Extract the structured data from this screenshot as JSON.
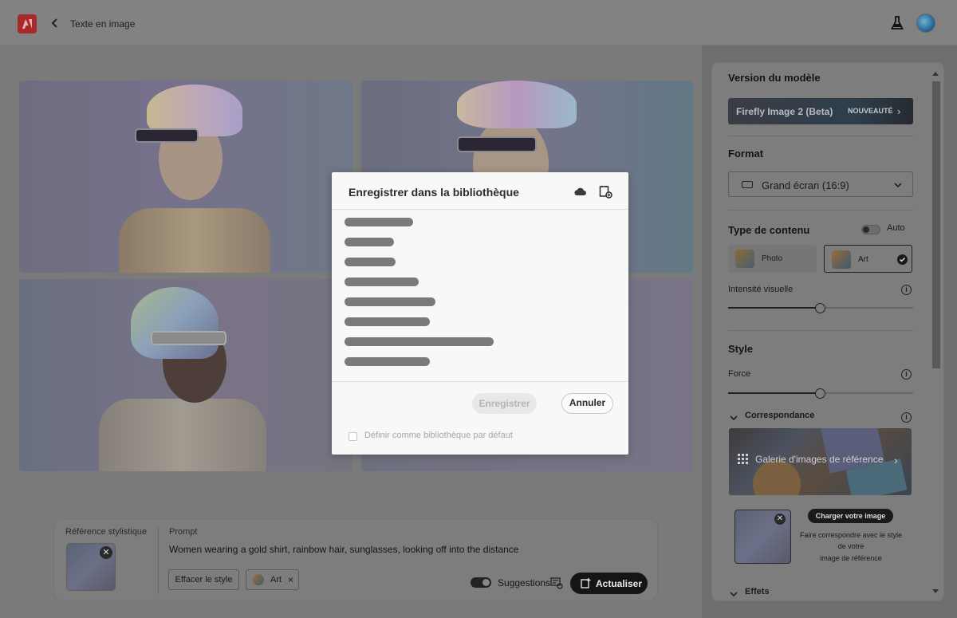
{
  "header": {
    "title": "Texte en image",
    "logo_icon": "adobe-icon",
    "back_icon": "chevron-left-icon",
    "flask_icon": "flask-icon",
    "avatar_icon": "user-avatar"
  },
  "prompt_panel": {
    "reference_label": "Référence stylistique",
    "prompt_label": "Prompt",
    "prompt_text": "Women wearing a gold shirt, rainbow hair, sunglasses, looking off into the distance",
    "clear_style_label": "Effacer le style",
    "art_chip_label": "Art",
    "art_chip_remove": "×",
    "suggestions_label": "Suggestions",
    "refresh_label": "Actualiser"
  },
  "right_panel": {
    "model_version_heading": "Version du modèle",
    "model_name": "Firefly Image 2 (Beta)",
    "model_badge": "NOUVEAUTÉ",
    "format_heading": "Format",
    "format_value": "Grand écran (16:9)",
    "content_type_heading": "Type de contenu",
    "auto_label": "Auto",
    "content_types": [
      {
        "label": "Photo",
        "selected": false
      },
      {
        "label": "Art",
        "selected": true
      }
    ],
    "visual_intensity_label": "Intensité visuelle",
    "visual_intensity_value": 0.5,
    "style_heading": "Style",
    "strength_label": "Force",
    "strength_value": 0.5,
    "match_label": "Correspondance",
    "gallery_label": "Galerie d'images de référence",
    "upload_button_label": "Charger votre image",
    "upload_desc_line1": "Faire correspondre avec le style",
    "upload_desc_line2": "de votre",
    "upload_desc_line3": "image de référence",
    "effects_label": "Effets"
  },
  "modal": {
    "title": "Enregistrer dans la bibliothèque",
    "save_label": "Enregistrer",
    "cancel_label": "Annuler",
    "default_library_label": "Définir comme bibliothèque par défaut"
  },
  "colors": {
    "overlay": "#6e6e6e",
    "modal_bg": "#f8f8f8",
    "primary_button": "#151515",
    "logo_red": "#a72a2a"
  }
}
